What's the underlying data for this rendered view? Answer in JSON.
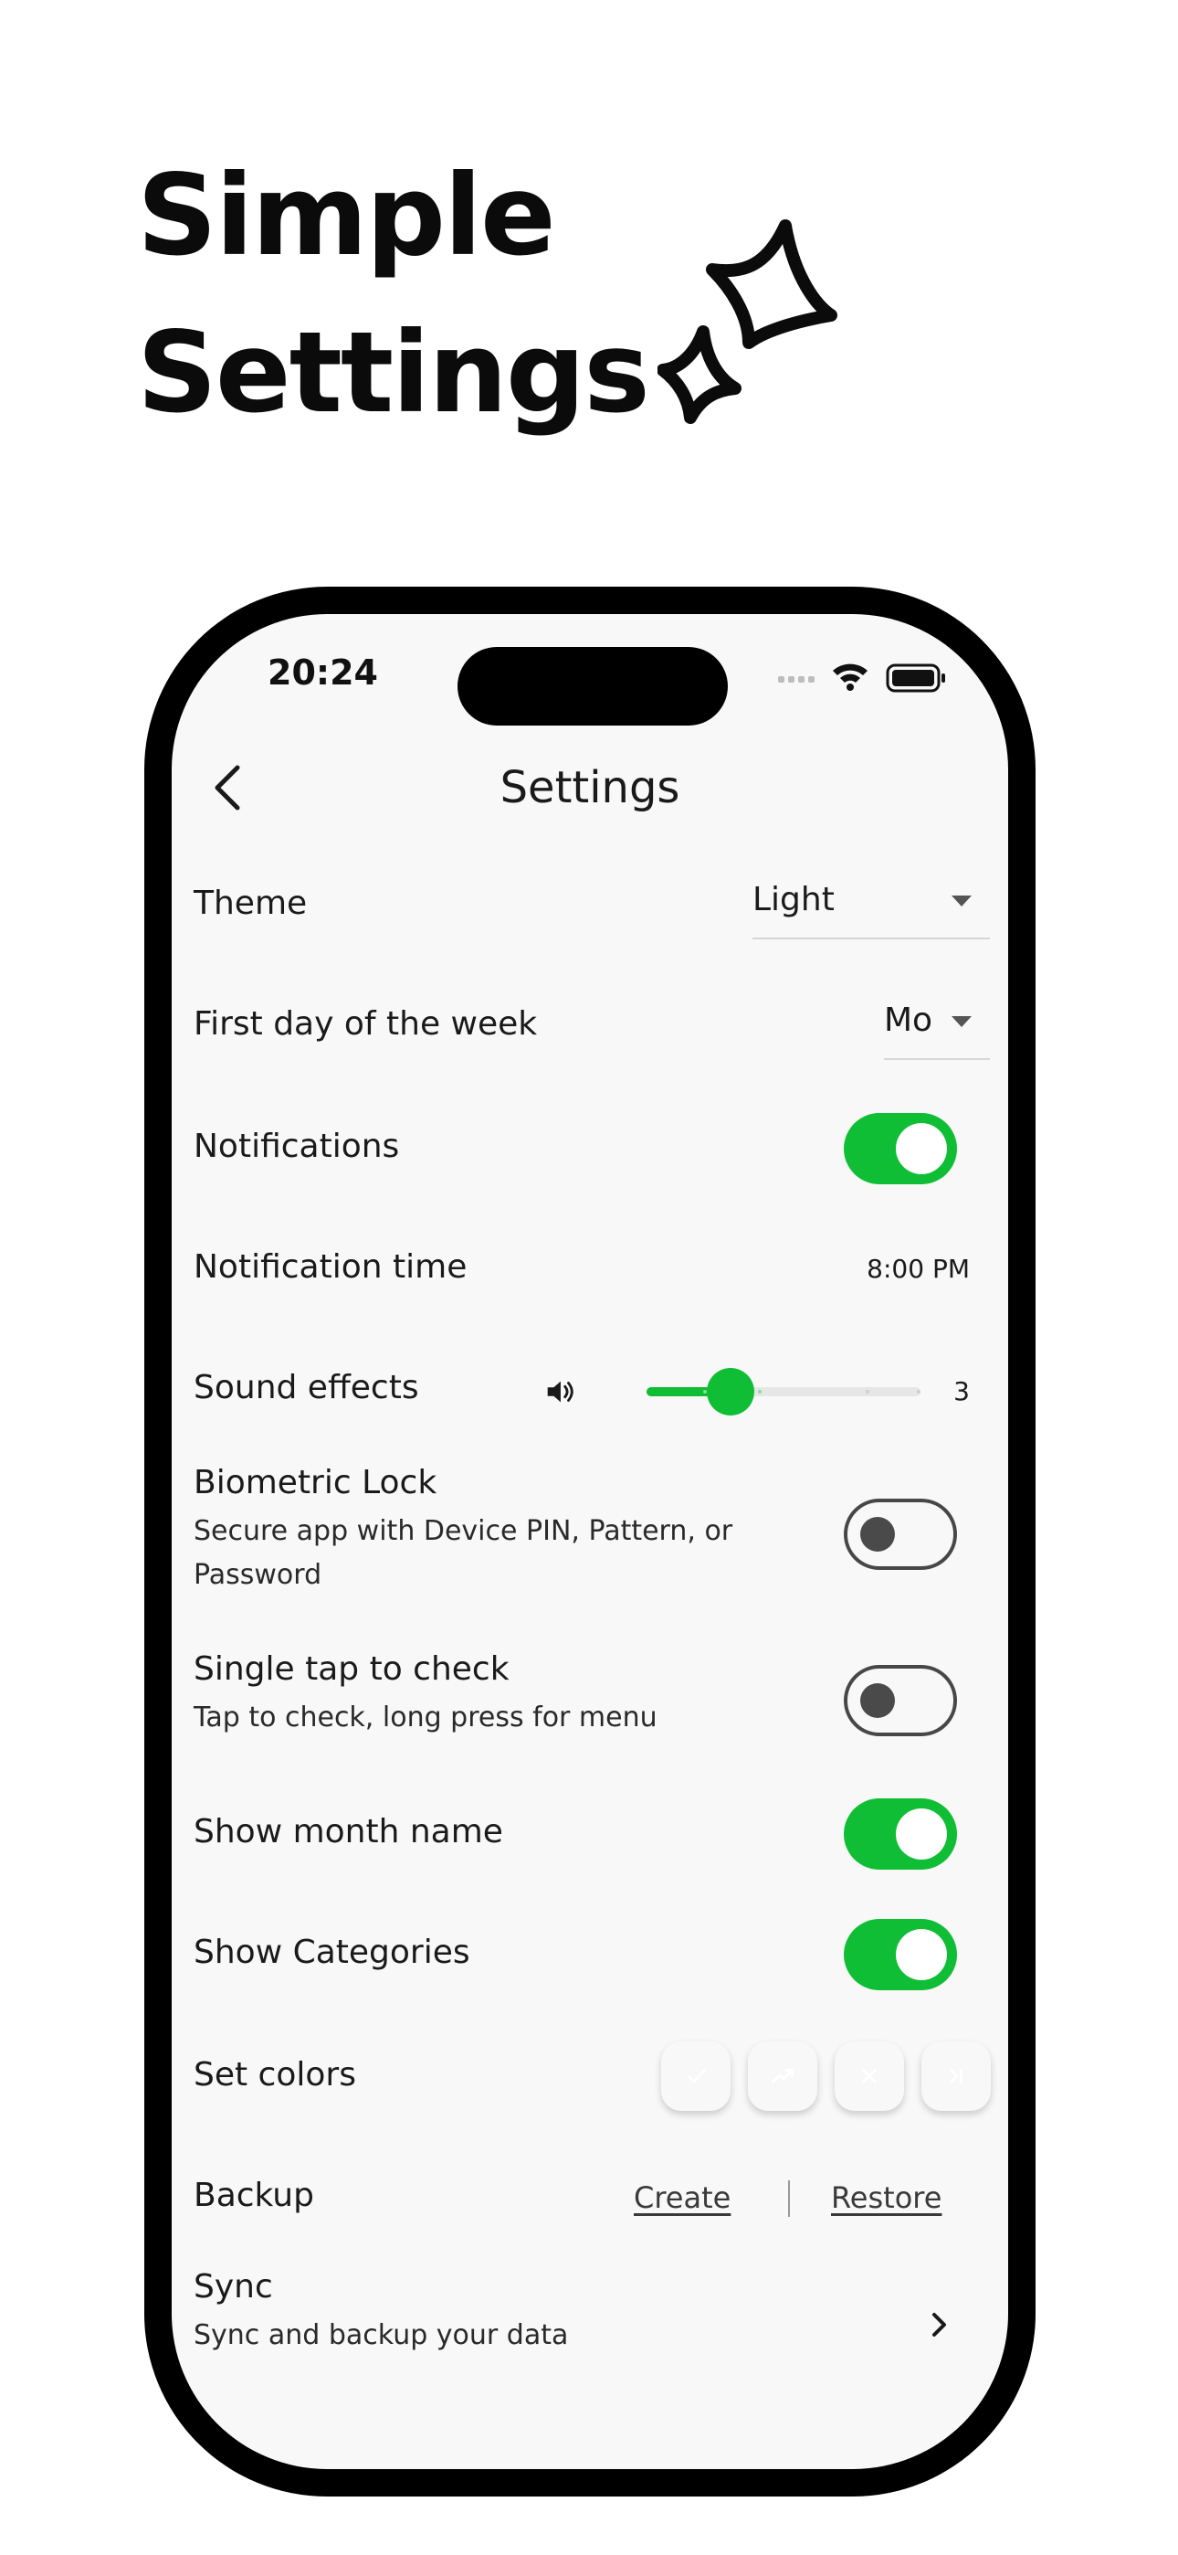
{
  "hero": {
    "line1": "Simple",
    "line2": "Settings"
  },
  "status_bar": {
    "time": "20:24",
    "icons": [
      "signal-icon",
      "wifi-icon",
      "battery-icon"
    ]
  },
  "nav": {
    "back_icon": "chevron-left-icon",
    "title": "Settings"
  },
  "settings": {
    "theme": {
      "label": "Theme",
      "value": "Light"
    },
    "first_day": {
      "label": "First day of the week",
      "value": "Mo"
    },
    "notifications": {
      "label": "Notifications",
      "enabled": true
    },
    "notification_time": {
      "label": "Notification time",
      "value": "8:00 PM"
    },
    "sound_effects": {
      "label": "Sound effects",
      "icon": "speaker-icon",
      "value": "3",
      "level": 3,
      "max": 5
    },
    "biometric_lock": {
      "label": "Biometric Lock",
      "description": "Secure app with Device PIN, Pattern, or Password",
      "enabled": false
    },
    "single_tap": {
      "label": "Single tap to check",
      "description": "Tap to check, long press for menu",
      "enabled": false
    },
    "show_month_name": {
      "label": "Show month name",
      "enabled": true
    },
    "show_categories": {
      "label": "Show Categories",
      "enabled": true
    },
    "set_colors": {
      "label": "Set colors",
      "swatches": [
        {
          "name": "check",
          "icon": "check-icon",
          "color": "#17c13b"
        },
        {
          "name": "trend",
          "icon": "trending-up-icon",
          "color": "#2a97f2"
        },
        {
          "name": "cross",
          "icon": "close-icon",
          "color": "#f2473b"
        },
        {
          "name": "skip",
          "icon": "skip-icon",
          "color": "#fbc534"
        }
      ]
    },
    "backup": {
      "label": "Backup",
      "create": "Create",
      "restore": "Restore"
    },
    "sync": {
      "label": "Sync",
      "description": "Sync and backup your data",
      "icon": "chevron-right-icon"
    }
  },
  "colors": {
    "accent_green": "#0fbe34",
    "phone_frame": "#000000",
    "screen_bg": "#f8f8f8"
  }
}
